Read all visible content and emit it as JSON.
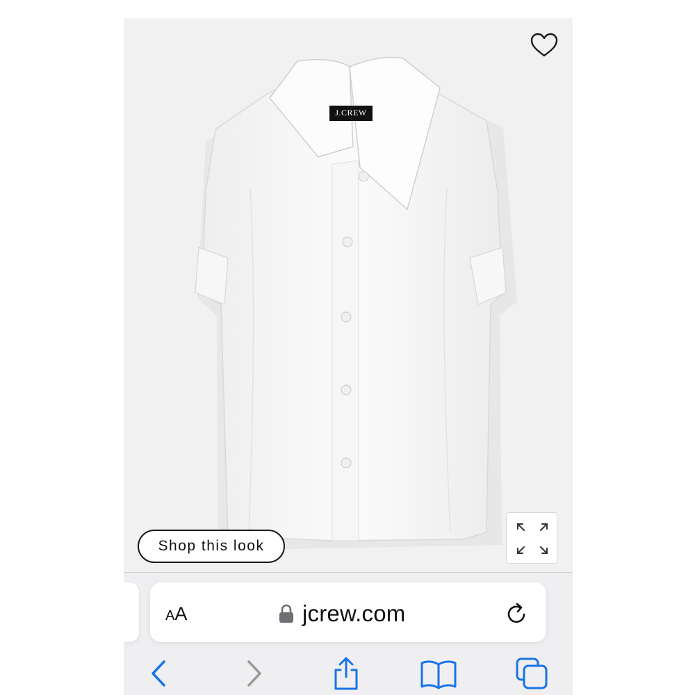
{
  "product": {
    "brand_tag": "J.CREW",
    "shop_look_label": "Shop this look"
  },
  "icons": {
    "wishlist": "heart-outline-icon",
    "expand": "expand-arrows-icon",
    "lock": "lock-icon",
    "reload": "reload-icon",
    "back": "chevron-left-icon",
    "forward": "chevron-right-icon",
    "share": "share-icon",
    "bookmarks": "book-icon",
    "tabs": "tabs-icon"
  },
  "browser": {
    "text_size_big": "A",
    "text_size_small": "A",
    "url": "jcrew.com"
  },
  "colors": {
    "accent": "#1a73e8",
    "disabled": "#9a9a9a",
    "background": "#f1f1f2"
  }
}
